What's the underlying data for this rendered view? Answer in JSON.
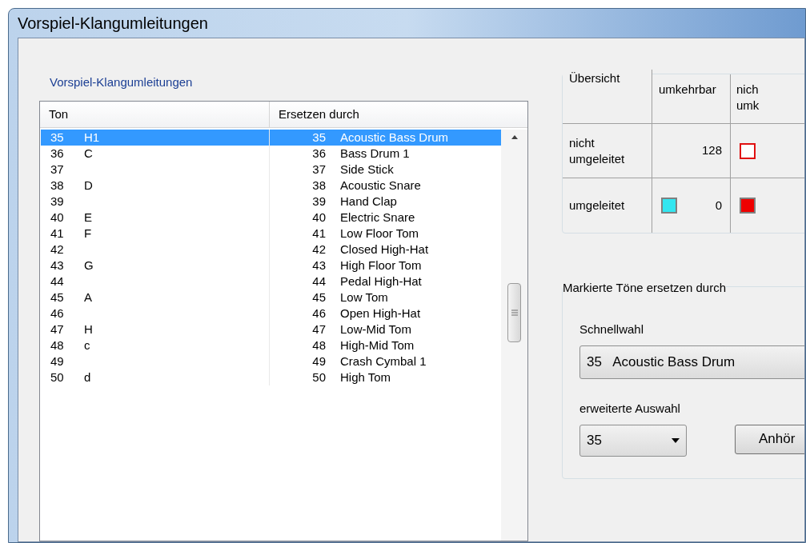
{
  "window": {
    "title": "Vorspiel-Klangumleitungen"
  },
  "group_title": "Vorspiel-Klangumleitungen",
  "list": {
    "columns": [
      "Ton",
      "Ersetzen durch"
    ],
    "rows": [
      {
        "number": "35",
        "note": "H1",
        "replacement_number": "35",
        "replacement_name": "Acoustic Bass Drum",
        "selected": true
      },
      {
        "number": "36",
        "note": "C",
        "replacement_number": "36",
        "replacement_name": "Bass Drum 1",
        "selected": false
      },
      {
        "number": "37",
        "replacement_number": "37",
        "replacement_name": "Side Stick",
        "selected": false
      },
      {
        "number": "38",
        "note": "D",
        "replacement_number": "38",
        "replacement_name": "Acoustic Snare",
        "selected": false
      },
      {
        "number": "39",
        "replacement_number": "39",
        "replacement_name": "Hand Clap",
        "selected": false
      },
      {
        "number": "40",
        "note": "E",
        "replacement_number": "40",
        "replacement_name": "Electric Snare",
        "selected": false
      },
      {
        "number": "41",
        "note": "F",
        "replacement_number": "41",
        "replacement_name": "Low Floor Tom",
        "selected": false
      },
      {
        "number": "42",
        "replacement_number": "42",
        "replacement_name": "Closed High-Hat",
        "selected": false
      },
      {
        "number": "43",
        "note": "G",
        "replacement_number": "43",
        "replacement_name": "High Floor Tom",
        "selected": false
      },
      {
        "number": "44",
        "replacement_number": "44",
        "replacement_name": "Pedal High-Hat",
        "selected": false
      },
      {
        "number": "45",
        "note": "A",
        "replacement_number": "45",
        "replacement_name": "Low Tom",
        "selected": false
      },
      {
        "number": "46",
        "replacement_number": "46",
        "replacement_name": "Open High-Hat",
        "selected": false
      },
      {
        "number": "47",
        "note": "H",
        "replacement_number": "47",
        "replacement_name": "Low-Mid Tom",
        "selected": false
      },
      {
        "number": "48",
        "note": "c",
        "replacement_number": "48",
        "replacement_name": "High-Mid Tom",
        "selected": false
      },
      {
        "number": "49",
        "replacement_number": "49",
        "replacement_name": "Crash Cymbal 1",
        "selected": false
      },
      {
        "number": "50",
        "note": "d",
        "replacement_number": "50",
        "replacement_name": "High Tom",
        "selected": false
      }
    ]
  },
  "overview": {
    "title": "Übersicht",
    "column_headers": [
      "umkehrbar",
      "nich umk"
    ],
    "rows": [
      {
        "label": "nicht umgeleitet",
        "cells": [
          {
            "value": "128"
          },
          {
            "kind": "outline",
            "color": "#e01010"
          }
        ]
      },
      {
        "label": "umgeleitet",
        "cells": [
          {
            "kind": "filled",
            "color": "#33e6f0",
            "value": "0"
          },
          {
            "kind": "filled",
            "color": "#ee0000"
          }
        ]
      }
    ]
  },
  "replace_group": {
    "title": "Markierte Töne ersetzen durch",
    "quick_label": "Schnellwahl",
    "quick_value": "35   Acoustic Bass Drum",
    "extended_label": "erweiterte Auswahl",
    "extended_value": "35",
    "listen_button": "Anhör"
  }
}
